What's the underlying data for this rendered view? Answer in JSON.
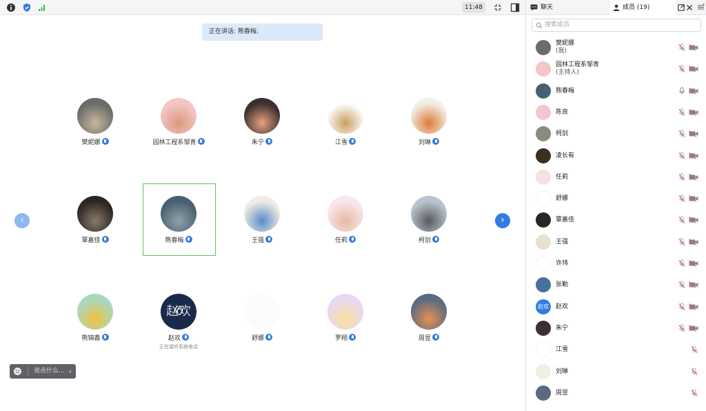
{
  "topbar": {
    "time": "11:48"
  },
  "speaking": "正在讲话: 熊春梅;",
  "grid": [
    {
      "name": "樊妮娜",
      "color": "#6b6b6b",
      "color2": "#c8b89a"
    },
    {
      "name": "园林工程系邹青",
      "color": "#f4c6c6",
      "color2": "#d89a7c"
    },
    {
      "name": "朱宁",
      "color": "#3a3030",
      "color2": "#e8a080"
    },
    {
      "name": "江雪",
      "color": "#ffffff",
      "color2": "#c9a060"
    },
    {
      "name": "刘琳",
      "color": "#f1efe4",
      "color2": "#e07a3a"
    },
    {
      "name": "覃嘉佳",
      "color": "#2b2622",
      "color2": "#8a7a6a"
    },
    {
      "name": "熊春梅",
      "color": "#4a6070",
      "color2": "#8fa0a8"
    },
    {
      "name": "王强",
      "color": "#f0ece4",
      "color2": "#5a8ac8"
    },
    {
      "name": "任莉",
      "color": "#f6e8ee",
      "color2": "#e8b8a0"
    },
    {
      "name": "柯剑",
      "color": "#b8c4d0",
      "color2": "#5a5a5a"
    },
    {
      "name": "熊锦鑫",
      "color": "#a8d8c0",
      "color2": "#f2c040"
    },
    {
      "name": "赵欢",
      "color": "#1a2a4a",
      "color2": "#ffffff",
      "sub": "正在接听系统电话",
      "glyph": "赵欢"
    },
    {
      "name": "舒娜",
      "color": "#ffffff",
      "color2": "#ffffff"
    },
    {
      "name": "罗翔",
      "color": "#e8d8f0",
      "color2": "#f8e0a0"
    },
    {
      "name": "周昱",
      "color": "#5a6a80",
      "color2": "#e89050"
    }
  ],
  "chat": {
    "placeholder": "说点什么..."
  },
  "panel": {
    "tab_chat": "聊天",
    "tab_members": "成员 (19)",
    "search_placeholder": "搜索成员",
    "members": [
      {
        "name": "樊妮娜",
        "role": "(我)",
        "color": "#6b6b6b",
        "mic": "muted",
        "cam": "off"
      },
      {
        "name": "园林工程系邹青",
        "role": "(主持人)",
        "color": "#f4c6c6",
        "mic": "muted",
        "cam": "off"
      },
      {
        "name": "熊春梅",
        "role": "",
        "color": "#4a6070",
        "mic": "on",
        "cam": "off"
      },
      {
        "name": "陈良",
        "role": "",
        "color": "#f2c6d0",
        "mic": "muted",
        "cam": "off"
      },
      {
        "name": "柯剑",
        "role": "",
        "color": "#8a8a80",
        "mic": "muted",
        "cam": "off"
      },
      {
        "name": "凌长有",
        "role": "",
        "color": "#3a3020",
        "mic": "muted",
        "cam": "off"
      },
      {
        "name": "任莉",
        "role": "",
        "color": "#f6e0e0",
        "mic": "muted",
        "cam": "off"
      },
      {
        "name": "舒娜",
        "role": "",
        "color": "#ffffff",
        "mic": "muted",
        "cam": "off"
      },
      {
        "name": "覃嘉佳",
        "role": "",
        "color": "#2b2622",
        "mic": "muted",
        "cam": "off"
      },
      {
        "name": "王强",
        "role": "",
        "color": "#e8e0d0",
        "mic": "muted",
        "cam": "off"
      },
      {
        "name": "许玮",
        "role": "",
        "color": "#ffffff",
        "mic": "muted",
        "cam": "off"
      },
      {
        "name": "张勤",
        "role": "",
        "color": "#4a70a0",
        "mic": "muted",
        "cam": "off"
      },
      {
        "name": "赵欢",
        "role": "",
        "color": "#2f7de1",
        "mic": "muted",
        "cam": "off",
        "glyph": "赵欢"
      },
      {
        "name": "朱宁",
        "role": "",
        "color": "#3a3030",
        "mic": "muted",
        "cam": "off"
      },
      {
        "name": "江雪",
        "role": "",
        "color": "#ffffff",
        "mic": "muted",
        "cam": "none"
      },
      {
        "name": "刘琳",
        "role": "",
        "color": "#f1efe4",
        "mic": "muted",
        "cam": "none"
      },
      {
        "name": "周昱",
        "role": "",
        "color": "#5a6a80",
        "mic": "muted",
        "cam": "none"
      }
    ]
  },
  "colors": {
    "accent": "#2f7de1",
    "nav_disabled": "#8fb6ee",
    "focus": "#5cc35c"
  }
}
